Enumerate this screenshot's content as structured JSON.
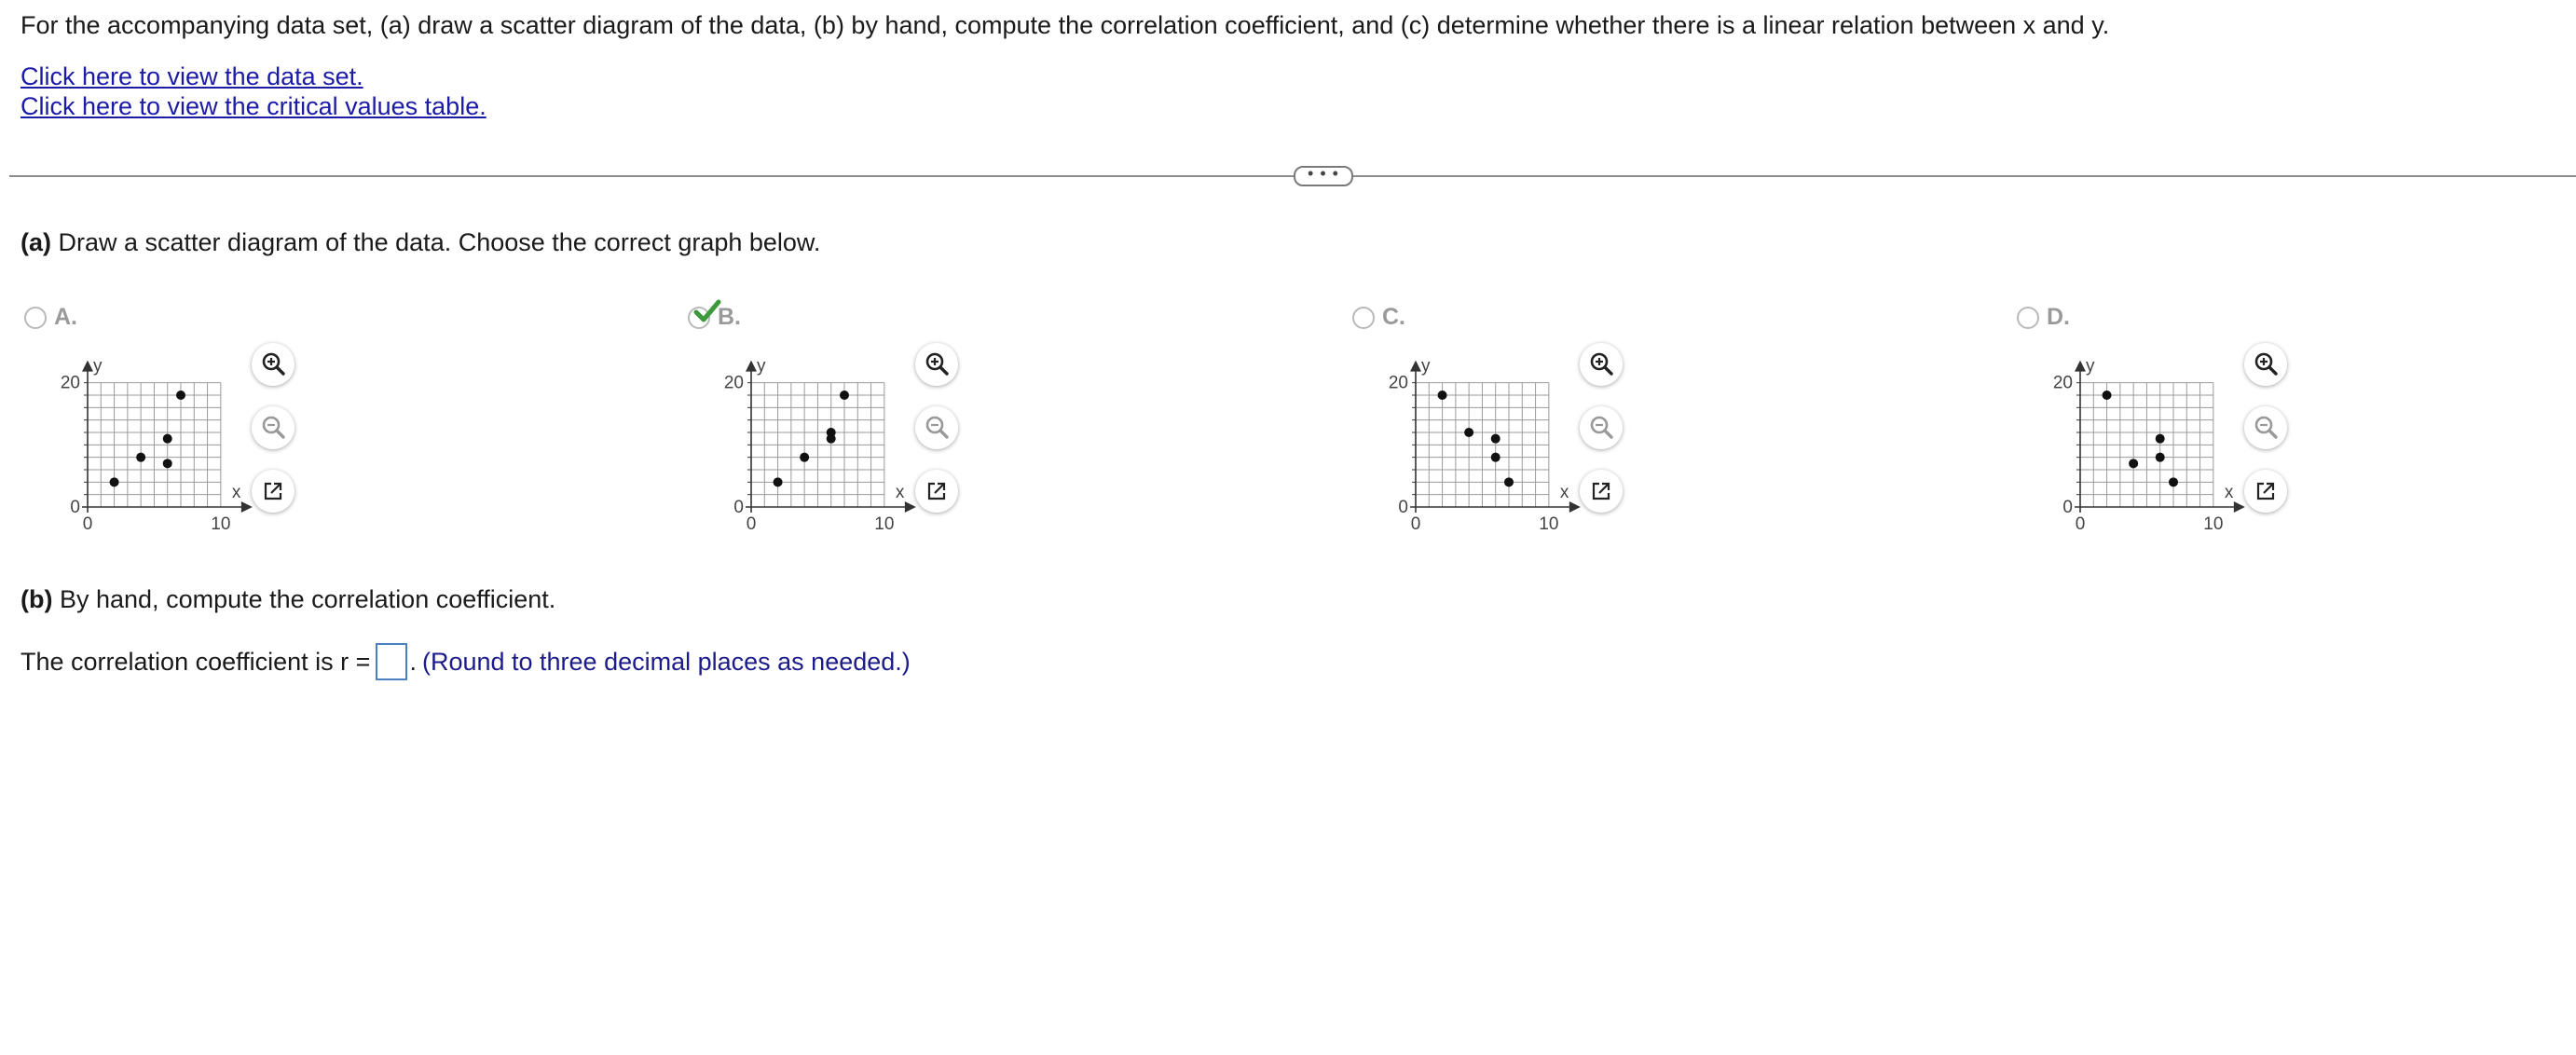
{
  "intro": "For the accompanying data set, (a) draw a scatter diagram of the data, (b) by hand, compute the correlation coefficient, and (c) determine whether there is a linear relation between x and y.",
  "links": {
    "data_set": "Click here to view the data set.",
    "critical_values": "Click here to view the critical values table."
  },
  "more_button": "• • •",
  "part_a": {
    "label": "(a)",
    "text": " Draw a scatter diagram of the data. Choose the correct graph below."
  },
  "options": [
    {
      "letter": "A.",
      "selected": false,
      "tools": [
        "zoom-in-icon",
        "zoom-out-icon",
        "open-external-icon"
      ]
    },
    {
      "letter": "B.",
      "selected": true,
      "tools": [
        "zoom-in-icon",
        "zoom-out-icon",
        "open-external-icon"
      ]
    },
    {
      "letter": "C.",
      "selected": false,
      "tools": [
        "zoom-in-icon",
        "zoom-out-icon",
        "open-external-icon"
      ]
    },
    {
      "letter": "D.",
      "selected": false,
      "tools": [
        "zoom-in-icon",
        "zoom-out-icon",
        "open-external-icon"
      ]
    }
  ],
  "colors": {
    "link": "#1b1ba8",
    "check": "#3c9a3c",
    "grid": "#9a9a9a",
    "answer_box": "#4a7fc0"
  },
  "part_b": {
    "label": "(b)",
    "text": " By hand, compute the correlation coefficient."
  },
  "answer": {
    "prefix": "The correlation coefficient is r =",
    "value": "",
    "suffix": ".",
    "hint": "(Round to three decimal places as needed.)"
  },
  "chart_data": [
    {
      "type": "scatter",
      "option": "A",
      "xlabel": "x",
      "ylabel": "y",
      "xlim": [
        0,
        10
      ],
      "ylim": [
        0,
        20
      ],
      "ticks": {
        "x": [
          "0",
          "10"
        ],
        "y": [
          "0",
          "20"
        ]
      },
      "points": [
        [
          2,
          4
        ],
        [
          4,
          8
        ],
        [
          6,
          11
        ],
        [
          6,
          7
        ],
        [
          7,
          18
        ]
      ]
    },
    {
      "type": "scatter",
      "option": "B",
      "xlabel": "x",
      "ylabel": "y",
      "xlim": [
        0,
        10
      ],
      "ylim": [
        0,
        20
      ],
      "ticks": {
        "x": [
          "0",
          "10"
        ],
        "y": [
          "0",
          "20"
        ]
      },
      "points": [
        [
          2,
          4
        ],
        [
          4,
          8
        ],
        [
          6,
          12
        ],
        [
          6,
          11
        ],
        [
          7,
          18
        ]
      ]
    },
    {
      "type": "scatter",
      "option": "C",
      "xlabel": "x",
      "ylabel": "y",
      "xlim": [
        0,
        10
      ],
      "ylim": [
        0,
        20
      ],
      "ticks": {
        "x": [
          "0",
          "10"
        ],
        "y": [
          "0",
          "20"
        ]
      },
      "points": [
        [
          2,
          18
        ],
        [
          4,
          12
        ],
        [
          6,
          11
        ],
        [
          6,
          8
        ],
        [
          7,
          4
        ]
      ]
    },
    {
      "type": "scatter",
      "option": "D",
      "xlabel": "x",
      "ylabel": "y",
      "xlim": [
        0,
        10
      ],
      "ylim": [
        0,
        20
      ],
      "ticks": {
        "x": [
          "0",
          "10"
        ],
        "y": [
          "0",
          "20"
        ]
      },
      "points": [
        [
          2,
          18
        ],
        [
          4,
          7
        ],
        [
          6,
          11
        ],
        [
          6,
          8
        ],
        [
          7,
          4
        ]
      ]
    }
  ]
}
